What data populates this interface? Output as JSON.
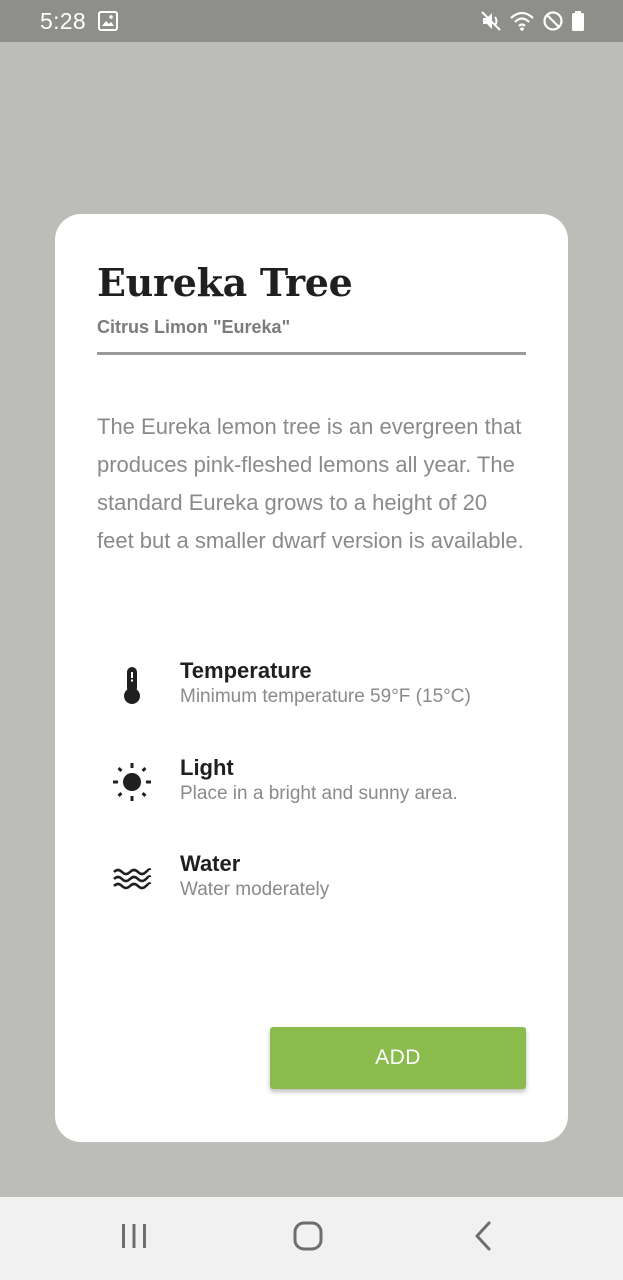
{
  "status_bar": {
    "time": "5:28",
    "icons": [
      "image-icon",
      "mute-icon",
      "wifi-icon",
      "do-not-disturb-icon",
      "battery-icon"
    ]
  },
  "card": {
    "title": "Eureka Tree",
    "subtitle": "Citrus Limon \"Eureka\"",
    "description": "The Eureka lemon tree is an evergreen that produces pink-fleshed lemons all year. The standard Eureka grows to a height of 20 feet but a smaller dwarf version is available.",
    "care": [
      {
        "icon": "thermometer-icon",
        "title": "Temperature",
        "detail": "Minimum temperature 59°F (15°C)"
      },
      {
        "icon": "sun-icon",
        "title": "Light",
        "detail": "Place in a bright and sunny area."
      },
      {
        "icon": "water-waves-icon",
        "title": "Water",
        "detail": "Water moderately"
      }
    ],
    "add_label": "ADD"
  },
  "nav_bar": {
    "buttons": [
      "recent-apps-icon",
      "home-icon",
      "back-icon"
    ]
  },
  "colors": {
    "background": "#bcbdb8",
    "status_bar": "#8e8f8b",
    "accent_green": "#8bbb4c",
    "card": "#ffffff"
  }
}
